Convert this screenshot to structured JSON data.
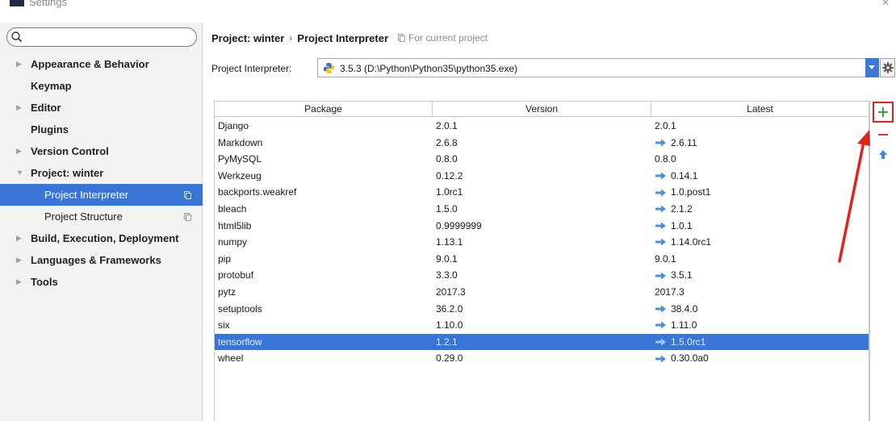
{
  "window": {
    "title": "Settings"
  },
  "search": {
    "placeholder": "",
    "value": ""
  },
  "sidebar": {
    "items": [
      {
        "label": "Appearance & Behavior",
        "expandable": true
      },
      {
        "label": "Keymap",
        "expandable": false
      },
      {
        "label": "Editor",
        "expandable": true
      },
      {
        "label": "Plugins",
        "expandable": false
      },
      {
        "label": "Version Control",
        "expandable": true
      },
      {
        "label": "Project: winter",
        "expandable": true,
        "expanded": true
      },
      {
        "label": "Project Interpreter",
        "sub": true,
        "selected": true
      },
      {
        "label": "Project Structure",
        "sub": true
      },
      {
        "label": "Build, Execution, Deployment",
        "expandable": true
      },
      {
        "label": "Languages & Frameworks",
        "expandable": true
      },
      {
        "label": "Tools",
        "expandable": true
      }
    ]
  },
  "breadcrumb": {
    "project": "Project: winter",
    "separator": "›",
    "page": "Project Interpreter",
    "scope": "For current project"
  },
  "interpreter": {
    "label": "Project Interpreter:",
    "value": "3.5.3 (D:\\Python\\Python35\\python35.exe)"
  },
  "table": {
    "columns": [
      "Package",
      "Version",
      "Latest"
    ],
    "rows": [
      {
        "package": "Django",
        "version": "2.0.1",
        "latest": "2.0.1",
        "update": false
      },
      {
        "package": "Markdown",
        "version": "2.6.8",
        "latest": "2.6.11",
        "update": true
      },
      {
        "package": "PyMySQL",
        "version": "0.8.0",
        "latest": "0.8.0",
        "update": false
      },
      {
        "package": "Werkzeug",
        "version": "0.12.2",
        "latest": "0.14.1",
        "update": true
      },
      {
        "package": "backports.weakref",
        "version": "1.0rc1",
        "latest": "1.0.post1",
        "update": true
      },
      {
        "package": "bleach",
        "version": "1.5.0",
        "latest": "2.1.2",
        "update": true
      },
      {
        "package": "html5lib",
        "version": "0.9999999",
        "latest": "1.0.1",
        "update": true
      },
      {
        "package": "numpy",
        "version": "1.13.1",
        "latest": "1.14.0rc1",
        "update": true
      },
      {
        "package": "pip",
        "version": "9.0.1",
        "latest": "9.0.1",
        "update": false
      },
      {
        "package": "protobuf",
        "version": "3.3.0",
        "latest": "3.5.1",
        "update": true
      },
      {
        "package": "pytz",
        "version": "2017.3",
        "latest": "2017.3",
        "update": false
      },
      {
        "package": "setuptools",
        "version": "36.2.0",
        "latest": "38.4.0",
        "update": true
      },
      {
        "package": "six",
        "version": "1.10.0",
        "latest": "1.11.0",
        "update": true
      },
      {
        "package": "tensorflow",
        "version": "1.2.1",
        "latest": "1.5.0rc1",
        "update": true,
        "selected": true
      },
      {
        "package": "wheel",
        "version": "0.29.0",
        "latest": "0.30.0a0",
        "update": true
      }
    ]
  },
  "toolbar": {
    "add_icon": "plus-icon",
    "remove_icon": "minus-icon",
    "upgrade_icon": "arrow-up-icon"
  },
  "colors": {
    "selection": "#3875d7",
    "update_arrow": "#4a90e2",
    "annotation": "#e0221d",
    "add": "#3aa33a",
    "remove": "#d9352f"
  }
}
